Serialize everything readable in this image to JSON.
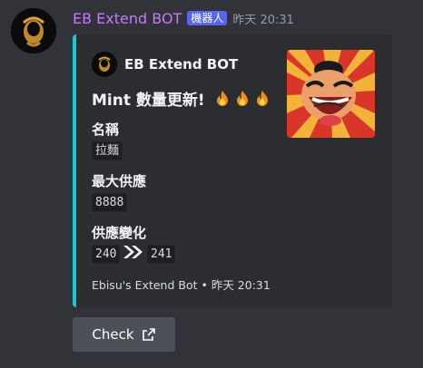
{
  "message": {
    "username": "EB Extend BOT",
    "bot_tag": "機器人",
    "timestamp": "昨天 20:31",
    "username_color": "#c27bff"
  },
  "embed": {
    "accent_color": "#1bc7d6",
    "author": {
      "name": "EB Extend BOT",
      "icon": "avatar-icon"
    },
    "title": "Mint 數量更新!",
    "title_emoji": [
      "fire-icon",
      "fire-icon",
      "fire-icon"
    ],
    "fields": [
      {
        "name": "名稱",
        "value": "拉麵"
      },
      {
        "name": "最大供應",
        "value": "8888"
      },
      {
        "name": "供應變化",
        "from": "240",
        "to": "241",
        "arrow_icon": "double-chevron-right-icon"
      }
    ],
    "thumbnail": "laughing-samurai-thumbnail",
    "footer": "Ebisu's Extend Bot • 昨天 20:31"
  },
  "button": {
    "label": "Check",
    "icon": "external-link-icon"
  }
}
